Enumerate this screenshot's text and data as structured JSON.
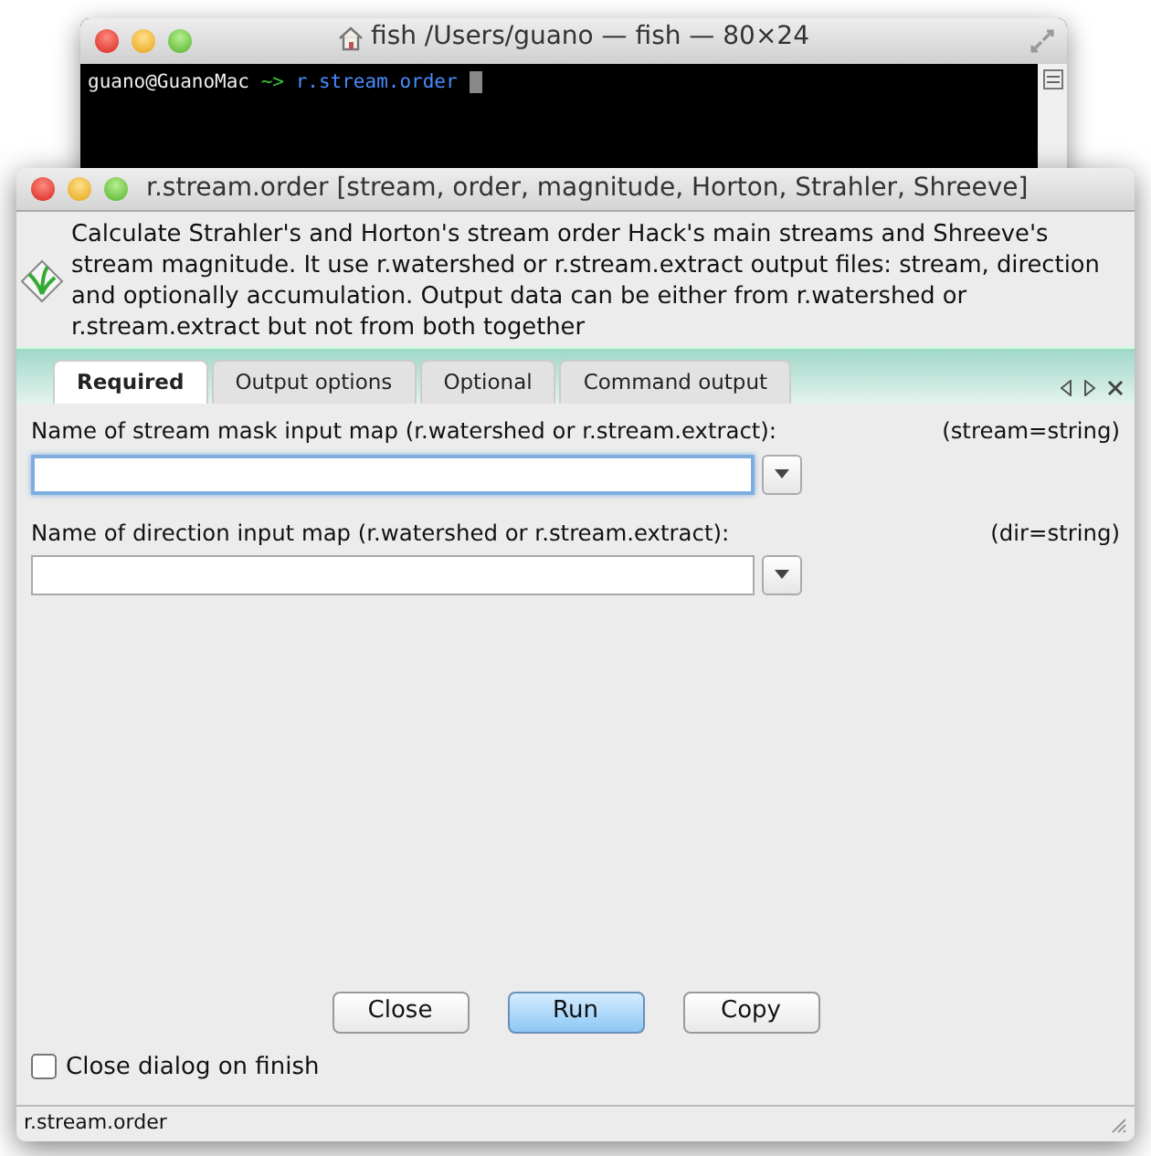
{
  "terminal": {
    "title": "fish  /Users/guano — fish — 80×24",
    "prompt_user": "guano@GuanoMac",
    "prompt_sign": "~>",
    "command": "r.stream.order"
  },
  "dialog": {
    "title": "r.stream.order [stream, order, magnitude, Horton, Strahler, Shreeve]",
    "description": "Calculate Strahler's and Horton's stream order Hack's main streams and Shreeve's stream magnitude. It use r.watershed or r.stream.extract output files: stream, direction and optionally accumulation. Output data can be either from r.watershed or r.stream.extract but not from both together",
    "tabs": [
      {
        "label": "Required",
        "selected": true
      },
      {
        "label": "Output options",
        "selected": false
      },
      {
        "label": "Optional",
        "selected": false
      },
      {
        "label": "Command output",
        "selected": false
      }
    ],
    "fields": [
      {
        "label": "Name of stream mask input map (r.watershed or r.stream.extract):",
        "param": "(stream=string)",
        "focused": true
      },
      {
        "label": "Name of direction input map (r.watershed or r.stream.extract):",
        "param": "(dir=string)",
        "focused": false
      }
    ],
    "buttons": [
      {
        "label": "Close",
        "default": false
      },
      {
        "label": "Run",
        "default": true
      },
      {
        "label": "Copy",
        "default": false
      }
    ],
    "close_on_finish": {
      "label": "Close dialog on finish",
      "checked": false
    },
    "status_bar": "r.stream.order"
  }
}
